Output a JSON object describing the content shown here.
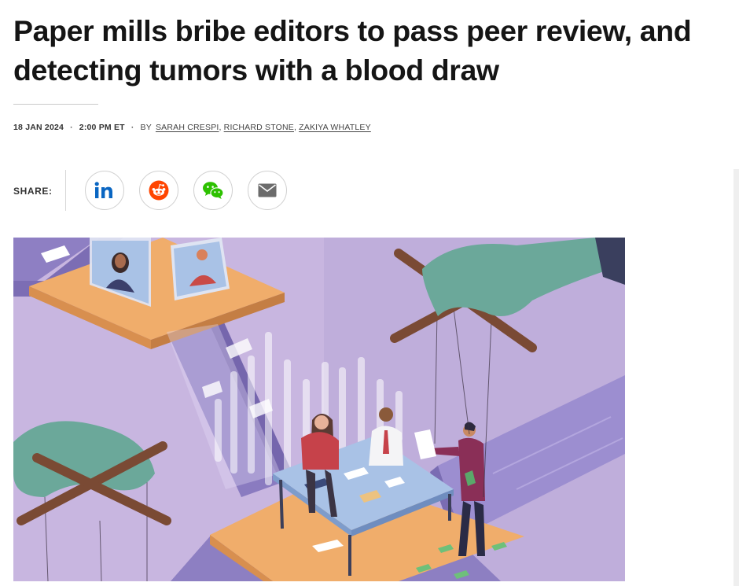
{
  "article": {
    "headline": "Paper mills bribe editors to pass peer review, and detecting tumors with a blood draw",
    "date": "18 JAN 2024",
    "time": "2:00 PM ET",
    "by_prefix": "BY",
    "authors": [
      "SARAH CRESPI",
      "RICHARD STONE",
      "ZAKIYA WHATLEY"
    ]
  },
  "share": {
    "label": "SHARE:",
    "buttons": [
      {
        "icon": "linkedin-icon",
        "color": "#0a66c2"
      },
      {
        "icon": "reddit-icon",
        "color": "#ff4500"
      },
      {
        "icon": "wechat-icon",
        "color": "#2dc100"
      },
      {
        "icon": "email-icon",
        "color": "#6b6b6b"
      }
    ]
  },
  "hero_image": {
    "palette": {
      "background": "#c8b6e0",
      "platform": "#f0ad6b",
      "hand": "#6ba89a",
      "cross": "#7a4a34",
      "table": "#a9c2e6"
    }
  }
}
